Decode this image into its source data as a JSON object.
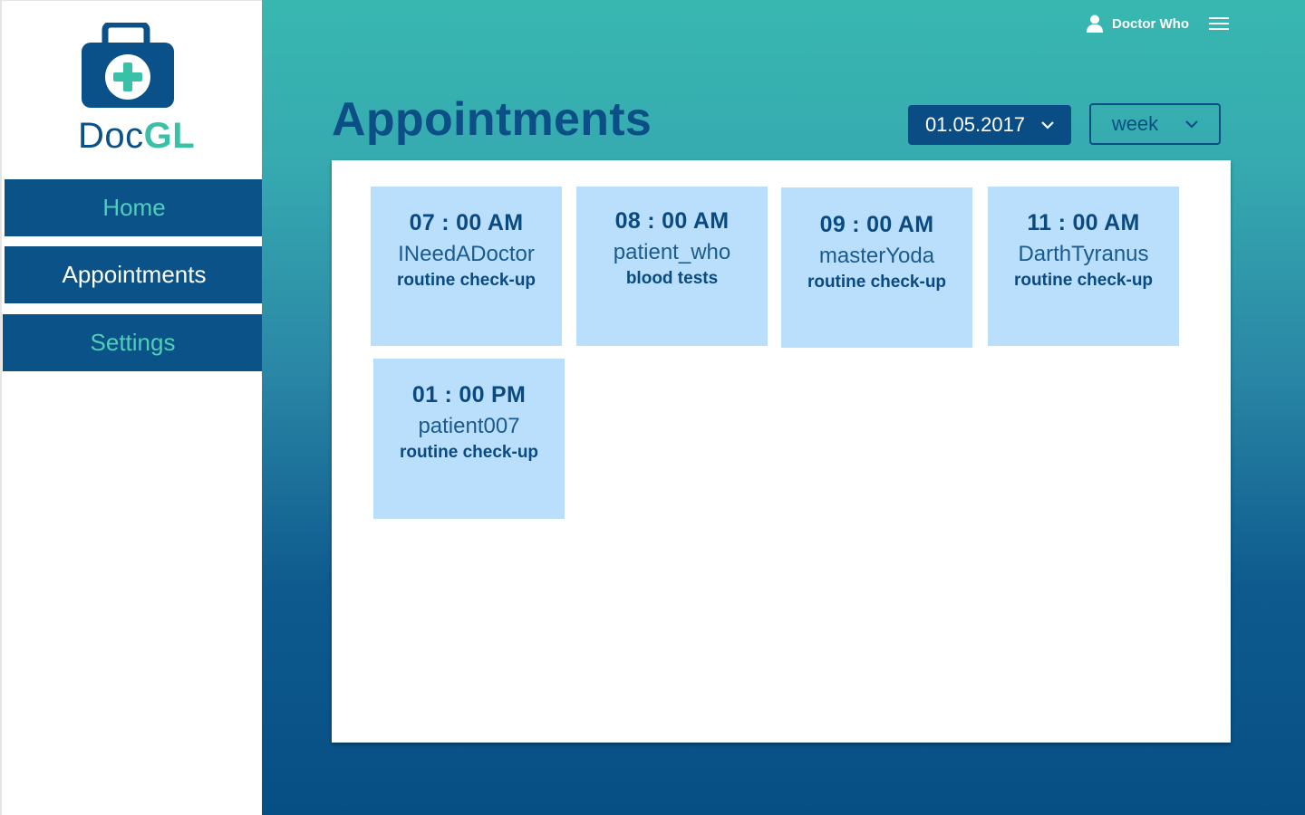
{
  "app": {
    "name_part1": "Doc",
    "name_part2": "GL"
  },
  "sidebar": {
    "items": [
      {
        "label": "Home"
      },
      {
        "label": "Appointments"
      },
      {
        "label": "Settings"
      }
    ]
  },
  "topbar": {
    "user_name": "Doctor Who",
    "user_icon": "user-icon",
    "menu_icon": "hamburger-menu-icon"
  },
  "page": {
    "title": "Appointments"
  },
  "filters": {
    "date": "01.05.2017",
    "range": "week"
  },
  "appointments": [
    {
      "time": "07 : 00 AM",
      "patient": "INeedADoctor",
      "reason": "routine check-up"
    },
    {
      "time": "08 : 00 AM",
      "patient": "patient_who",
      "reason": "blood tests"
    },
    {
      "time": "09 : 00 AM",
      "patient": "masterYoda",
      "reason": "routine check-up"
    },
    {
      "time": "11 : 00 AM",
      "patient": "DarthTyranus",
      "reason": "routine check-up"
    },
    {
      "time": "01 : 00 PM",
      "patient": "patient007",
      "reason": "routine check-up"
    }
  ],
  "colors": {
    "primary": "#0a5287",
    "accent": "#39c1a8",
    "card": "#b9dffd"
  }
}
